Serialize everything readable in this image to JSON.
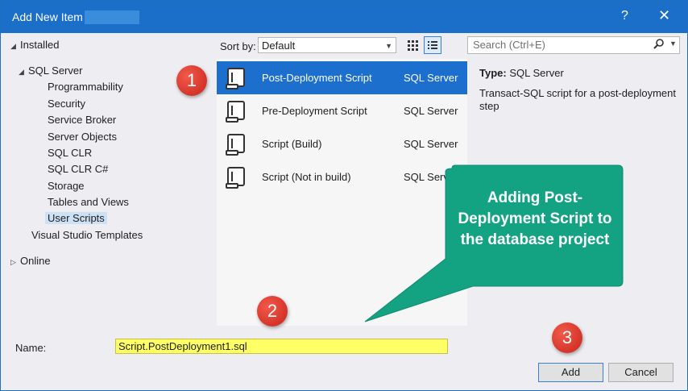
{
  "window": {
    "title": "Add New Item -",
    "help_glyph": "?",
    "close_glyph": "✕"
  },
  "tree": {
    "installed": "Installed",
    "sql_server": "SQL Server",
    "children": [
      "Programmability",
      "Security",
      "Service Broker",
      "Server Objects",
      "SQL CLR",
      "SQL CLR C#",
      "Storage",
      "Tables and Views",
      "User Scripts"
    ],
    "selected": "User Scripts",
    "visual_studio_templates": "Visual Studio Templates",
    "online": "Online"
  },
  "toolbar": {
    "sort_label": "Sort by:",
    "sort_value": "Default",
    "search_placeholder": "Search (Ctrl+E)"
  },
  "templates": [
    {
      "name": "Post-Deployment Script",
      "type": "SQL Server",
      "selected": true
    },
    {
      "name": "Pre-Deployment Script",
      "type": "SQL Server",
      "selected": false
    },
    {
      "name": "Script (Build)",
      "type": "SQL Server",
      "selected": false
    },
    {
      "name": "Script (Not in build)",
      "type": "SQL Serv",
      "selected": false
    }
  ],
  "details": {
    "type_label": "Type:",
    "type_value": "SQL Server",
    "description": "Transact-SQL script for a post-deployment step"
  },
  "footer": {
    "name_label": "Name:",
    "name_value": "Script.PostDeployment1.sql",
    "add_label": "Add",
    "cancel_label": "Cancel"
  },
  "annotations": {
    "badges": [
      "1",
      "2",
      "3"
    ],
    "callout": "Adding Post-Deployment Script to the database project",
    "callout_color": "#13a383",
    "badge_color": "#d9302a"
  },
  "colors": {
    "titlebar": "#1b6fc9",
    "selection": "#1c6fcc",
    "name_highlight": "#ffff66"
  }
}
